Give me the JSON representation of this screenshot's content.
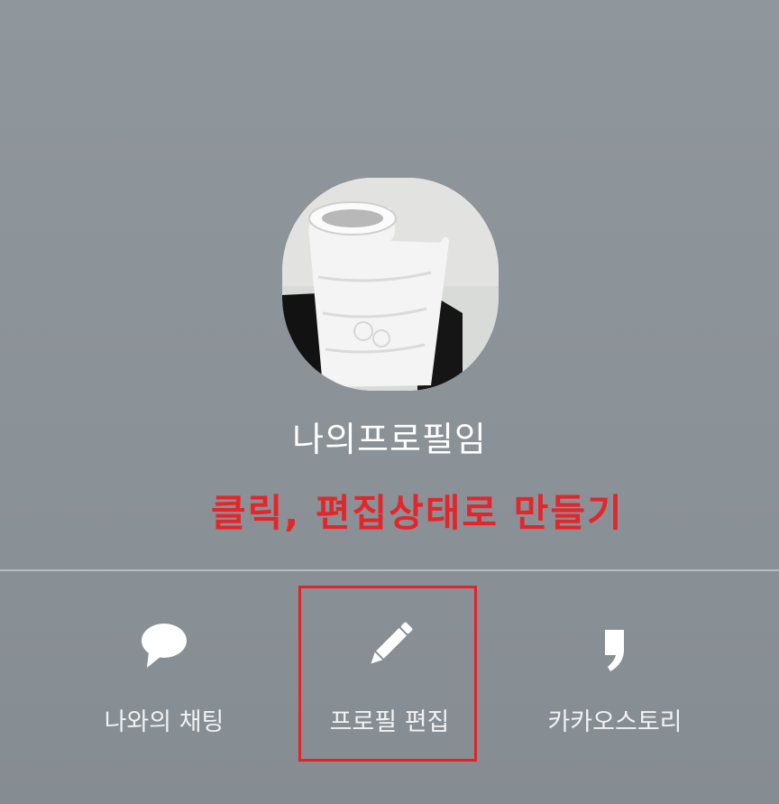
{
  "profile": {
    "name": "나의프로필임",
    "avatar_icon": "paper-towel-roll-photo"
  },
  "annotation": {
    "text": "클릭, 편집상태로 만들기",
    "color": "#e4262b"
  },
  "actions": [
    {
      "label": "나와의 채팅",
      "icon": "speech-bubble-icon"
    },
    {
      "label": "프로필 편집",
      "icon": "pencil-icon"
    },
    {
      "label": "카카오스토리",
      "icon": "kakaostory-comma-icon"
    }
  ],
  "highlight": {
    "target": "프로필 편집",
    "color": "#e1232a"
  }
}
